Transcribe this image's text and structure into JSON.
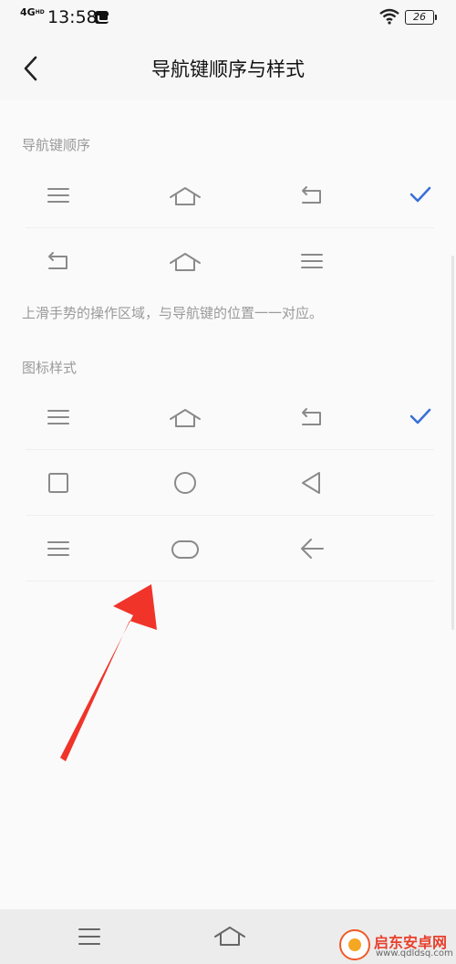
{
  "status_bar": {
    "network": "4G",
    "network_sup": "HD",
    "time": "13:58",
    "battery": "26"
  },
  "header": {
    "title": "导航键顺序与样式",
    "back_icon": "chevron-left-icon"
  },
  "order_section": {
    "label": "导航键顺序",
    "options": [
      {
        "icons": [
          "menu-icon",
          "home-icon",
          "back-icon"
        ],
        "selected": true
      },
      {
        "icons": [
          "back-icon",
          "home-icon",
          "menu-icon"
        ],
        "selected": false
      }
    ],
    "hint": "上滑手势的操作区域，与导航键的位置一一对应。"
  },
  "style_section": {
    "label": "图标样式",
    "options": [
      {
        "icons": [
          "menu-icon",
          "home-icon",
          "back-icon"
        ],
        "selected": true
      },
      {
        "icons": [
          "square-icon",
          "circle-icon",
          "triangle-icon"
        ],
        "selected": false
      },
      {
        "icons": [
          "menu-icon",
          "pill-icon",
          "arrow-left-icon"
        ],
        "selected": false
      }
    ]
  },
  "nav_bar": {
    "keys": [
      "menu-icon",
      "home-icon"
    ]
  },
  "watermark": {
    "name": "启东安卓网",
    "url": "www.qdldsq.com"
  },
  "colors": {
    "accent": "#3a6fd8",
    "arrow": "#f0342a",
    "icon": "#8a8a8a"
  }
}
